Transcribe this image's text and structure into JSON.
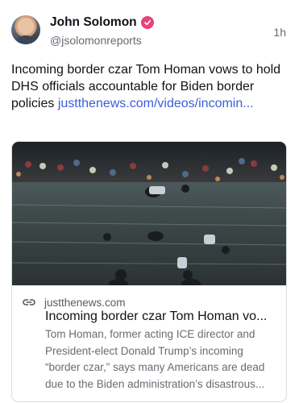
{
  "author": {
    "name": "John Solomon",
    "handle": "@jsolomonreports",
    "verified_color": "#e8437a"
  },
  "post": {
    "time": "1h",
    "text": "Incoming border czar Tom Homan vows to hold DHS officials accountable for Biden border policies ",
    "link_text": "justthenews.com/videos/incomin...",
    "link_color": "#3a5ed8"
  },
  "link_card": {
    "domain": "justthenews.com",
    "title": "Incoming border czar Tom Homan vo...",
    "description": "Tom Homan, former acting ICE director and President-elect Donald Trump’s incoming “border czar,” says many Americans are dead due to the Biden administration’s disastrous...",
    "icon": "link-icon"
  }
}
